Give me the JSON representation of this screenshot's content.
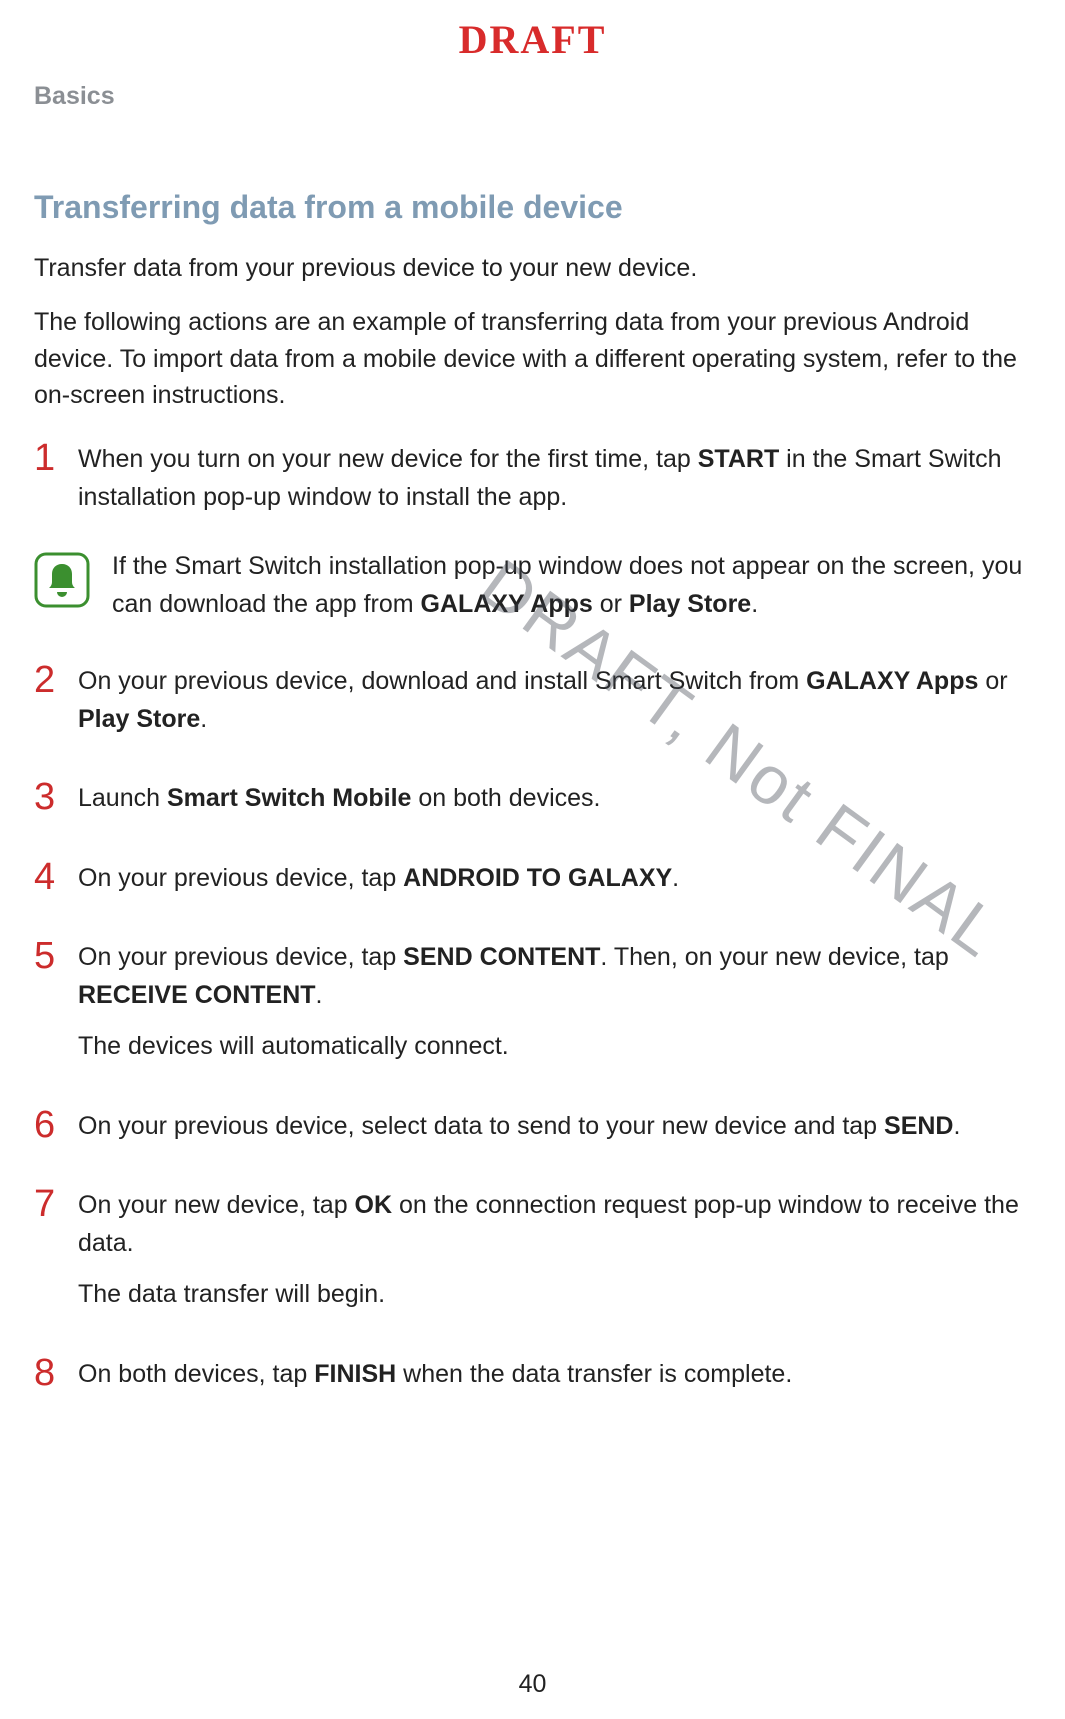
{
  "top_banner": "DRAFT",
  "running_header": "Basics",
  "watermark": "DRAFT, Not FINAL",
  "section_title": "Transferring data from a mobile device",
  "intro1": "Transfer data from your previous device to your new device.",
  "intro2": "The following actions are an example of transferring data from your previous Android device. To import data from a mobile device with a different operating system, refer to the on-screen instructions.",
  "steps": {
    "s1": {
      "num": "1",
      "t1": "When you turn on your new device for the first time, tap ",
      "b1": "START",
      "t2": " in the Smart Switch installation pop-up window to install the app."
    },
    "note": {
      "t1": "If the Smart Switch installation pop-up window does not appear on the screen, you can download the app from ",
      "b1": "GALAXY Apps",
      "t2": " or ",
      "b2": "Play Store",
      "t3": "."
    },
    "s2": {
      "num": "2",
      "t1": "On your previous device, download and install Smart Switch from ",
      "b1": "GALAXY Apps",
      "t2": " or ",
      "b2": "Play Store",
      "t3": "."
    },
    "s3": {
      "num": "3",
      "t1": "Launch ",
      "b1": "Smart Switch Mobile",
      "t2": " on both devices."
    },
    "s4": {
      "num": "4",
      "t1": "On your previous device, tap ",
      "b1": "ANDROID TO GALAXY",
      "t2": "."
    },
    "s5": {
      "num": "5",
      "t1": "On your previous device, tap ",
      "b1": "SEND CONTENT",
      "t2": ". Then, on your new device, tap ",
      "b2": "RECEIVE CONTENT",
      "t3": ".",
      "p2": "The devices will automatically connect."
    },
    "s6": {
      "num": "6",
      "t1": "On your previous device, select data to send to your new device and tap ",
      "b1": "SEND",
      "t2": "."
    },
    "s7": {
      "num": "7",
      "t1": "On your new device, tap ",
      "b1": "OK",
      "t2": " on the connection request pop-up window to receive the data.",
      "p2": "The data transfer will begin."
    },
    "s8": {
      "num": "8",
      "t1": "On both devices, tap ",
      "b1": "FINISH",
      "t2": " when the data transfer is complete."
    }
  },
  "page_number": "40"
}
